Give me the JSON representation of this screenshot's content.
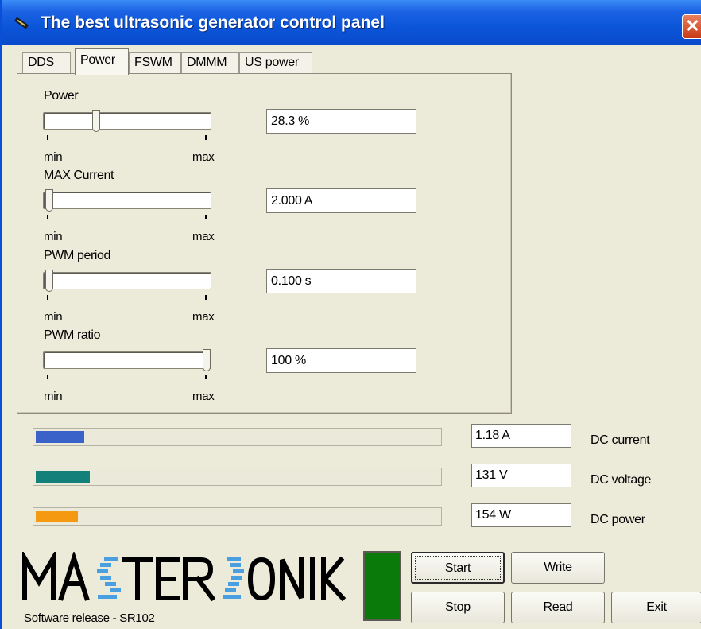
{
  "window": {
    "title": "The best ultrasonic generator control panel",
    "close_symbol": "✕",
    "icon": "app-icon"
  },
  "tabs": [
    {
      "label": "DDS",
      "active": false
    },
    {
      "label": "Power",
      "active": true
    },
    {
      "label": "FSWM",
      "active": false
    },
    {
      "label": "DMMM",
      "active": false
    },
    {
      "label": "US power",
      "active": false
    }
  ],
  "controls": [
    {
      "label": "Power",
      "value": "28.3 %",
      "level": 0.3,
      "min_label": "min",
      "max_label": "max"
    },
    {
      "label": "MAX Current",
      "value": "2.000 A",
      "level": 0.0,
      "min_label": "min",
      "max_label": "max"
    },
    {
      "label": "PWM period",
      "value": "0.100 s",
      "level": 0.0,
      "min_label": "min",
      "max_label": "max"
    },
    {
      "label": "PWM ratio",
      "value": "100 %",
      "level": 1.0,
      "min_label": "min",
      "max_label": "max"
    }
  ],
  "meters": [
    {
      "label": "DC current",
      "value": "1.18 A",
      "level": 0.12,
      "color": "#3a62c8"
    },
    {
      "label": "DC voltage",
      "value": "131 V",
      "level": 0.135,
      "color": "#13807a"
    },
    {
      "label": "DC power",
      "value": "154 W",
      "level": 0.105,
      "color": "#f59a10"
    }
  ],
  "buttons": {
    "start": "Start",
    "write": "Write",
    "stop": "Stop",
    "read": "Read",
    "exit": "Exit"
  },
  "status_led_color": "#0a7a0a",
  "footer": {
    "logo_text": "MASTERSONIC",
    "release": "Software release - SR102"
  }
}
